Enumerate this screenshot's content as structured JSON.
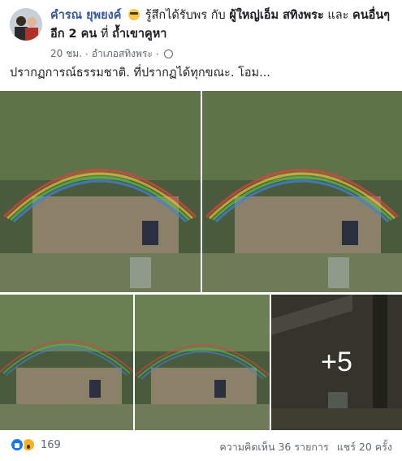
{
  "post": {
    "author": "คำรณ ยุพยงค์",
    "feeling_text": "รู้สึกได้รับพร กับ",
    "tagged_person": "ผู้ใหญ่เอ็ม สทิงพระ",
    "and_text": "และ",
    "others_text": "คนอื่นๆ อีก 2 คน",
    "at_text": "ที่",
    "place": "ถ้ำเขาคูหา",
    "time": "20 ชม.",
    "location": "อำเภอสทิงพระ",
    "separator": "·",
    "privacy_icon": "globe-icon",
    "more_icon": "more-options-icon",
    "text": "ปรากฏการณ์ธรรมชาติ. ที่ปรากฏได้ทุกขณะ. โอม..."
  },
  "photos": {
    "more_count": "+5",
    "scene": "rainbow arch over cave entrance"
  },
  "footer": {
    "reaction_icons": [
      "like-icon",
      "wow-icon"
    ],
    "reaction_count": "169",
    "comments": "ความคิดเห็น 36 รายการ",
    "shares": "แชร์ 20 ครั้ง"
  },
  "colors": {
    "link": "#385898",
    "meta": "#606770",
    "like": "#1877f2",
    "wow": "#f7b125"
  }
}
